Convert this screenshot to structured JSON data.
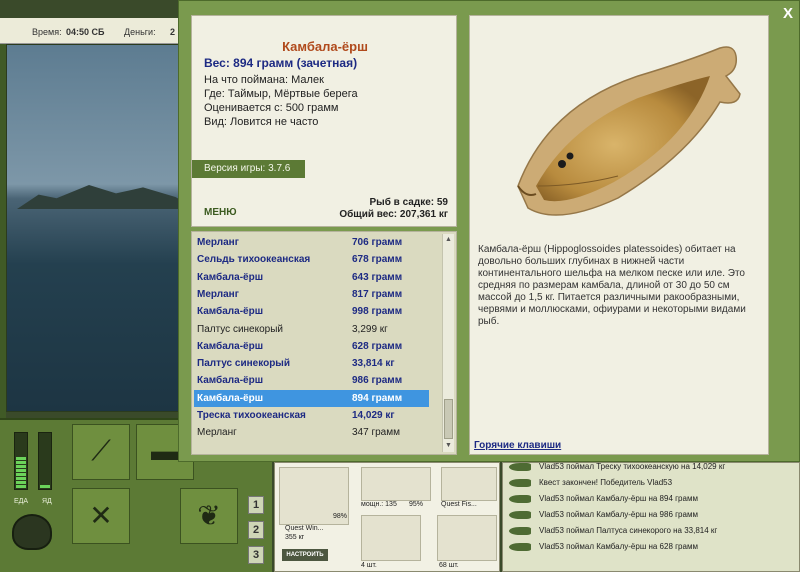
{
  "hud": {
    "time_label": "Время:",
    "time_value": "04:50 СБ",
    "money_label": "Деньги:",
    "money_value": "2",
    "energy_label": "ЕДА",
    "poison_label": "ЯД",
    "quickslots": [
      "1",
      "2",
      "3"
    ],
    "energy_level": 0.55,
    "poison_level": 0.05
  },
  "tackle": {
    "rod_name": "Quest Win...",
    "rod_weight": "355 кг",
    "rod_condition": "98%",
    "reel_name": "мощн.: 135",
    "reel_condition": "95%",
    "line_name": "Quest Fis...",
    "hook_count": "4 шт.",
    "bait_count": "68 шт.",
    "setup_button": "НАСТРОИТЬ"
  },
  "chat": [
    "Vlad53 поймал Треску тихоокеанскую на 14,029 кг",
    "Квест закончен! Победитель Vlad53",
    "Vlad53 поймал Камбалу-ёрш на 894 грамм",
    "Vlad53 поймал Камбалу-ёрш на 986 грамм",
    "Vlad53 поймал Палтуса синекорого на 33,814 кг",
    "Vlad53 поймал Камбалу-ёрш на 628 грамм"
  ],
  "popup": {
    "close": "X",
    "fish_name": "Камбала-ёрш",
    "weight": "Вес: 894 грамм (зачетная)",
    "caught_on": "На что поймана: Малек",
    "location": "Где: Таймыр, Мёртвые берега",
    "valued_from": "Оценивается с: 500 грамм",
    "species": "Вид: Ловится не часто",
    "version_label": "Версия игры:",
    "version_value": "3.7.6",
    "menu": "МЕНЮ",
    "fish_in_net": "Рыб в садке: 59",
    "total_weight": "Общий вес: 207,361 кг",
    "description": "Камбала-ёрш (Hippoglossoides platessoides) обитает на довольно больших глубинах в нижней части континентального шельфа на мелком песке или иле. Это средняя по размерам камбала, длиной от 30 до 50 см массой до 1,5 кг. Питается различными ракообразными, червями и моллюсками, офиурами и некоторыми видами рыб.",
    "hotkeys": "Горячие клавиши"
  },
  "catch_list": [
    {
      "name": "Мерланг",
      "weight": "706 грамм",
      "style": "b"
    },
    {
      "name": "Сельдь тихоокеанская",
      "weight": "678 грамм",
      "style": "b"
    },
    {
      "name": "Камбала-ёрш",
      "weight": "643 грамм",
      "style": "b"
    },
    {
      "name": "Мерланг",
      "weight": "817 грамм",
      "style": "b"
    },
    {
      "name": "Камбала-ёрш",
      "weight": "998 грамм",
      "style": "b"
    },
    {
      "name": "Палтус синекорый",
      "weight": "3,299 кг",
      "style": "p"
    },
    {
      "name": "Камбала-ёрш",
      "weight": "628 грамм",
      "style": "b"
    },
    {
      "name": "Палтус синекорый",
      "weight": "33,814 кг",
      "style": "b"
    },
    {
      "name": "Камбала-ёрш",
      "weight": "986 грамм",
      "style": "b"
    },
    {
      "name": "Камбала-ёрш",
      "weight": "894 грамм",
      "style": "sel"
    },
    {
      "name": "Треска тихоокеанская",
      "weight": "14,029 кг",
      "style": "b"
    },
    {
      "name": "Мерланг",
      "weight": "347 грамм",
      "style": "p"
    }
  ]
}
